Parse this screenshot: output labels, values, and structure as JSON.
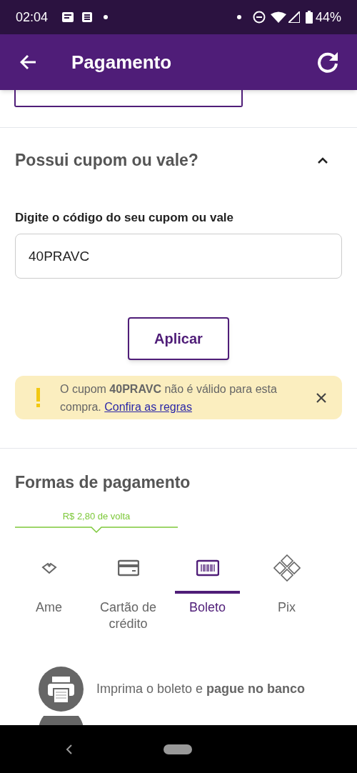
{
  "status_bar": {
    "time": "02:04",
    "battery": "44%"
  },
  "app_bar": {
    "title": "Pagamento"
  },
  "coupon": {
    "title": "Possui cupom ou vale?",
    "expanded": true,
    "label": "Digite o código do seu cupom ou vale",
    "value": "40PRAVC",
    "button": "Aplicar",
    "alert": {
      "message": "O cupom **40PRAVC** não é válido para esta compra.",
      "link": "Confira as regras"
    }
  },
  "payment": {
    "title": "Formas de pagamento",
    "cashback": "R$ 2,80 de volta",
    "tabs": [
      {
        "kind": "ame",
        "label": "Ame",
        "selected": false
      },
      {
        "kind": "card",
        "label": "Cartão de crédito",
        "selected": false
      },
      {
        "kind": "boleto",
        "label": "Boleto",
        "selected": true
      },
      {
        "kind": "pix",
        "label": "Pix",
        "selected": false
      }
    ],
    "steps": [
      {
        "kind": "print",
        "text": "Imprima o boleto e **pague no banco**"
      }
    ]
  }
}
